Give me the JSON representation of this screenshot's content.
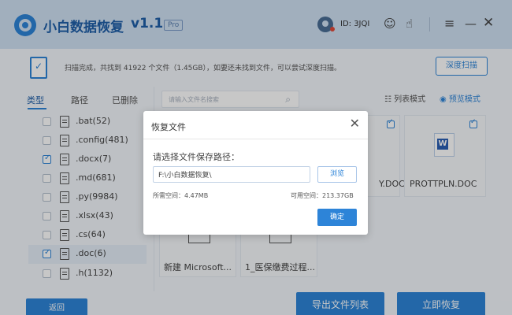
{
  "app": {
    "title": "小白数据恢复",
    "version": "v1.1",
    "badge": "Pro",
    "user_id": "ID: 3JQI",
    "accent_color": "#2d84d8",
    "titlebar_color": "#cfe0f3",
    "icons": {
      "user": "user-avatar-icon",
      "robot": "robot-icon",
      "hand": "hand-pointer-icon",
      "menu": "hamburger-menu-icon",
      "minimize": "minimize-icon",
      "close": "close-icon"
    }
  },
  "info_bar": {
    "message": "扫描完成，共找到 41922 个文件（1.45GB），如要还未找到文件，可以尝试深度扫描。",
    "deep_scan_label": "深度扫描"
  },
  "tabs": [
    "类型",
    "路径",
    "已删除"
  ],
  "search": {
    "placeholder": "请输入文件名搜索"
  },
  "view_modes": {
    "list": "列表模式",
    "preview": "预览模式",
    "active": "预览模式"
  },
  "file_types": [
    {
      "label": ".bat(52)",
      "checked": false
    },
    {
      "label": ".config(481)",
      "checked": false
    },
    {
      "label": ".docx(7)",
      "checked": true
    },
    {
      "label": ".md(681)",
      "checked": false
    },
    {
      "label": ".py(9984)",
      "checked": false
    },
    {
      "label": ".xlsx(43)",
      "checked": false
    },
    {
      "label": ".cs(64)",
      "checked": false
    },
    {
      "label": ".doc(6)",
      "checked": true,
      "selected": true
    },
    {
      "label": ".h(1132)",
      "checked": false
    }
  ],
  "files": [
    {
      "name": "Y.DOC",
      "checked": true
    },
    {
      "name": "PROTTPLN.DOC",
      "checked": true
    },
    {
      "name": "新建 Microsoft..."
    },
    {
      "name": "1_医保缴费过程..."
    }
  ],
  "bottom_buttons": {
    "back": "返回",
    "export": "导出文件列表",
    "recover": "立即恢复"
  },
  "dialog": {
    "title": "恢复文件",
    "prompt": "请选择文件保存路径：",
    "path_value": "F:\\小白数据恢复\\",
    "browse_label": "浏览",
    "required_space": "所需空间：4.47MB",
    "free_space": "可用空间：213.37GB",
    "ok_label": "确定"
  }
}
